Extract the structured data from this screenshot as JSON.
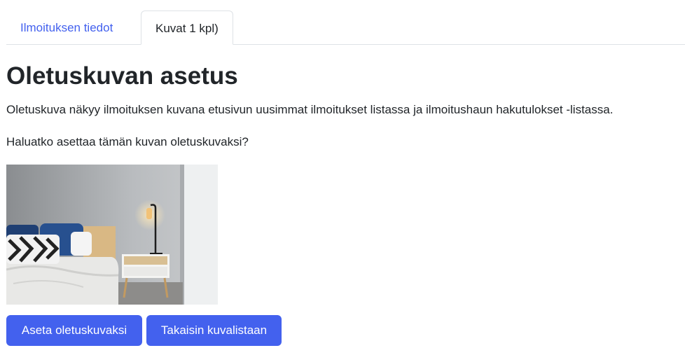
{
  "tabs": [
    {
      "label": "Ilmoituksen tiedot",
      "active": false
    },
    {
      "label": "Kuvat 1 kpl)",
      "active": true
    }
  ],
  "page": {
    "title": "Oletuskuvan asetus",
    "description": "Oletuskuva näkyy ilmoituksen kuvana etusivun uusimmat ilmoitukset listassa ja ilmoitushaun hakutulokset -listassa.",
    "question": "Haluatko asettaa tämän kuvan oletuskuvaksi?"
  },
  "actions": {
    "set_default_label": "Aseta oletuskuvaksi",
    "back_label": "Takaisin kuvalistaan"
  },
  "colors": {
    "accent": "#4361ee",
    "text": "#212529",
    "border": "#dee2e6"
  }
}
